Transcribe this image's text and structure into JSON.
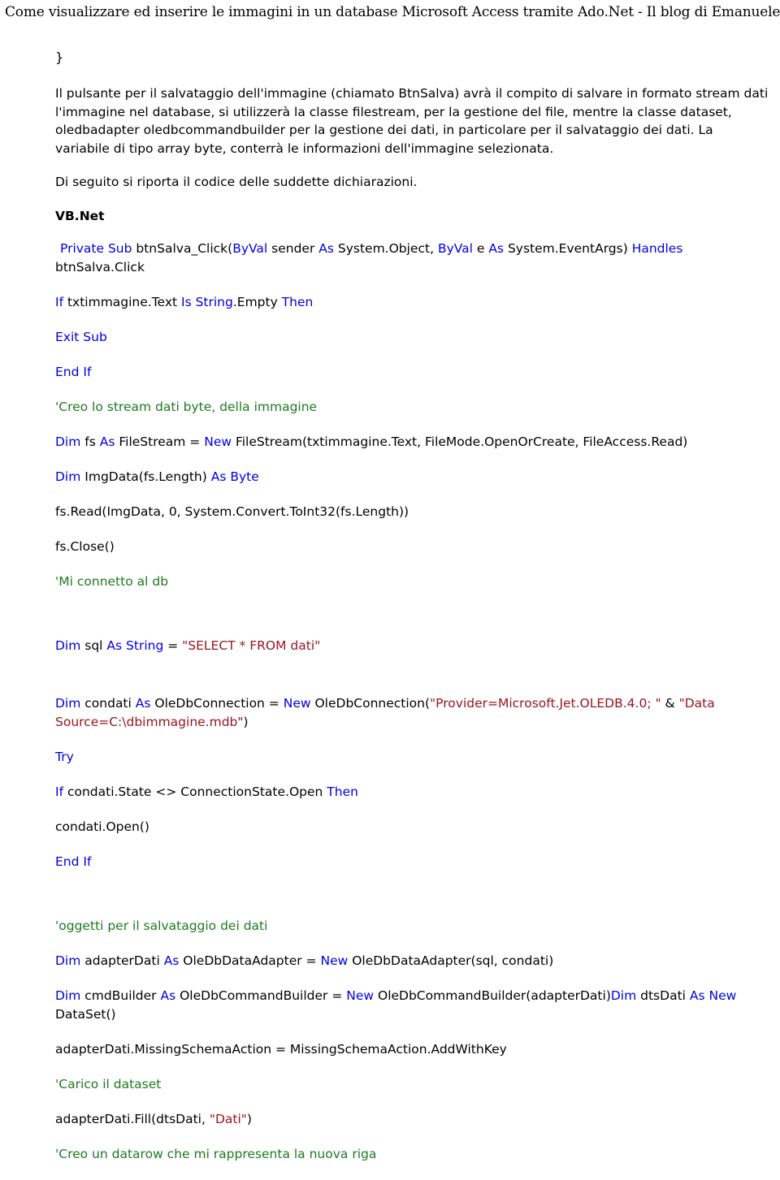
{
  "header": {
    "title": "Come visualizzare ed inserire le immagini in un database Microsoft Access tramite Ado.Net - Il blog di Emanuele Mattei in ambito Database"
  },
  "colors": {
    "keyword": "#0000e0",
    "comment": "#1d7a21",
    "string": "#9a1420",
    "plain": "#000000",
    "background": "#ffffff"
  },
  "body": {
    "closing_brace": "}",
    "paragraph_1": "Il pulsante per il salvataggio dell'immagine (chiamato BtnSalva) avrà il compito di salvare in formato stream dati l'immagine nel database, si utilizzerà la classe filestream, per la gestione del file, mentre la classe dataset, oledbadapter oledbcommandbuilder per la gestione dei dati, in particolare per il salvataggio dei dati. La variabile di tipo array byte, conterrà le informazioni dell'immagine selezionata.",
    "paragraph_2": "Di seguito si riporta il codice delle suddette dichiarazioni.",
    "section_heading": "VB.Net"
  },
  "code": {
    "line_01": {
      "t1_kw": "Private Sub",
      "t2_pl": " btnSalva_Click(",
      "t3_kw": "ByVal",
      "t4_pl": " sender ",
      "t5_kw": "As",
      "t6_pl": " System.Object, ",
      "t7_kw": "ByVal",
      "t8_pl": " e ",
      "t9_kw": "As",
      "t10_pl": " System.EventArgs) ",
      "t11_kw": "Handles",
      "t12_pl": " btnSalva.Click"
    },
    "line_02": {
      "t1_kw": "If",
      "t2_pl": " txtimmagine.Text ",
      "t3_kw": "Is String",
      "t4_pl": ".Empty ",
      "t5_kw": "Then"
    },
    "line_03": {
      "t1_kw": "Exit Sub"
    },
    "line_04": {
      "t1_kw": "End If"
    },
    "line_05": {
      "t1_cmt": "'Creo lo stream dati byte, della immagine"
    },
    "line_06": {
      "t1_kw": "Dim",
      "t2_pl": " fs ",
      "t3_kw": "As",
      "t4_pl": " FileStream = ",
      "t5_kw": "New",
      "t6_pl": " FileStream(txtimmagine.Text, FileMode.OpenOrCreate, FileAccess.Read)"
    },
    "line_07": {
      "t1_kw": "Dim",
      "t2_pl": " ImgData(fs.Length) ",
      "t3_kw": "As Byte"
    },
    "line_08": {
      "t1_pl": "fs.Read(ImgData, 0, System.Convert.ToInt32(fs.Length))"
    },
    "line_09": {
      "t1_pl": "fs.Close()"
    },
    "line_10": {
      "t1_cmt": "'Mi connetto al db"
    },
    "line_11": {
      "t1_kw": "Dim",
      "t2_pl": " sql ",
      "t3_kw": "As String",
      "t4_pl": " = ",
      "t5_str": "\"SELECT * FROM dati\""
    },
    "line_12": {
      "t1_kw": "Dim",
      "t2_pl": " condati ",
      "t3_kw": "As",
      "t4_pl": " OleDbConnection = ",
      "t5_kw": "New",
      "t6_pl": " OleDbConnection(",
      "t7_str": "\"Provider=Microsoft.Jet.OLEDB.4.0; \"",
      "t8_pl": " & ",
      "t9_str": "\"Data Source=C:\\dbimmagine.mdb\"",
      "t10_pl": ")"
    },
    "line_13": {
      "t1_kw": "Try"
    },
    "line_14": {
      "t1_kw": "If",
      "t2_pl": " condati.State <> ConnectionState.Open ",
      "t3_kw": "Then"
    },
    "line_15": {
      "t1_pl": "condati.Open()"
    },
    "line_16": {
      "t1_kw": "End If"
    },
    "line_17": {
      "t1_cmt": "'oggetti per il salvataggio dei dati"
    },
    "line_18": {
      "t1_kw": "Dim",
      "t2_pl": " adapterDati ",
      "t3_kw": "As",
      "t4_pl": " OleDbDataAdapter = ",
      "t5_kw": "New",
      "t6_pl": " OleDbDataAdapter(sql, condati)"
    },
    "line_19": {
      "t1_kw": "Dim",
      "t2_pl": " cmdBuilder ",
      "t3_kw": "As",
      "t4_pl": " OleDbCommandBuilder = ",
      "t5_kw": "New",
      "t6_pl": " OleDbCommandBuilder(adapterDati)",
      "t7_kw": "Dim",
      "t8_pl": " dtsDati ",
      "t9_kw": "As New",
      "t10_pl": " DataSet()"
    },
    "line_20": {
      "t1_pl": "adapterDati.MissingSchemaAction = MissingSchemaAction.AddWithKey"
    },
    "line_21": {
      "t1_cmt": "'Carico il dataset"
    },
    "line_22": {
      "t1_pl": "adapterDati.Fill(dtsDati, ",
      "t2_str": "\"Dati\"",
      "t3_pl": ")"
    },
    "line_23": {
      "t1_cmt": "'Creo un datarow che mi rappresenta la nuova riga"
    }
  }
}
